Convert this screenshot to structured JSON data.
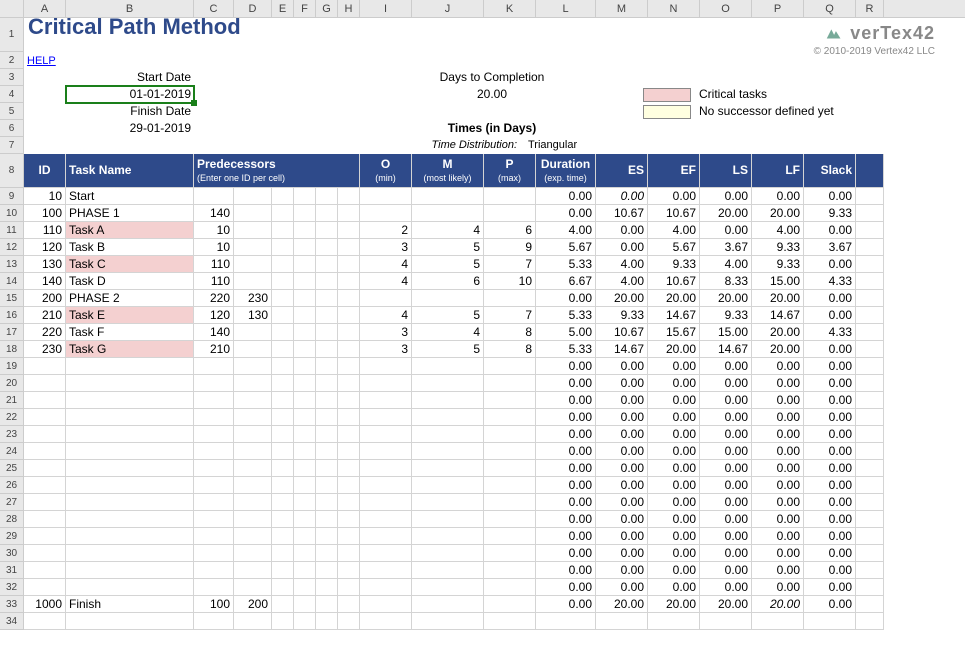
{
  "title": "Critical Path Method",
  "brand": "verTex42",
  "copyright": "© 2010-2019 Vertex42 LLC",
  "help": "HELP",
  "labels": {
    "start_date": "Start Date",
    "start_date_val": "01-01-2019",
    "finish_date": "Finish Date",
    "finish_date_val": "29-01-2019",
    "days_to_completion": "Days to Completion",
    "days_to_completion_val": "20.00",
    "times_heading": "Times (in Days)",
    "time_dist_label": "Time Distribution:",
    "time_dist_val": "Triangular",
    "legend_crit": "Critical tasks",
    "legend_nosucc": "No successor defined yet"
  },
  "headers": {
    "id": "ID",
    "task_name": "Task Name",
    "predecessors": "Predecessors",
    "predecessors_sub": "(Enter one ID per cell)",
    "o": "O",
    "o_sub": "(min)",
    "m": "M",
    "m_sub": "(most likely)",
    "p": "P",
    "p_sub": "(max)",
    "duration": "Duration",
    "duration_sub": "(exp. time)",
    "es": "ES",
    "ef": "EF",
    "ls": "LS",
    "lf": "LF",
    "slack": "Slack"
  },
  "column_letters": [
    "A",
    "B",
    "C",
    "D",
    "E",
    "F",
    "G",
    "H",
    "I",
    "J",
    "K",
    "L",
    "M",
    "N",
    "O",
    "P",
    "Q",
    "R"
  ],
  "row_numbers_section1": [
    "1",
    "2",
    "3",
    "4",
    "5",
    "6",
    "7"
  ],
  "row_numbers_section2": [
    "8"
  ],
  "row_numbers_section3": [
    "9",
    "10",
    "11",
    "12",
    "13",
    "14",
    "15",
    "16",
    "17",
    "18",
    "19",
    "20",
    "21",
    "22",
    "23",
    "24",
    "25",
    "26",
    "27",
    "28",
    "29",
    "30",
    "31",
    "32",
    "33",
    "34"
  ],
  "tasks": [
    {
      "id": "10",
      "name": "Start",
      "pred": [
        "",
        ""
      ],
      "o": "",
      "m": "",
      "p": "",
      "dur": "0.00",
      "es": "0.00",
      "es_i": true,
      "ef": "0.00",
      "ls": "0.00",
      "lf": "0.00",
      "slack": "0.00",
      "crit": false
    },
    {
      "id": "100",
      "name": "PHASE 1",
      "pred": [
        "140",
        ""
      ],
      "o": "",
      "m": "",
      "p": "",
      "dur": "0.00",
      "es": "10.67",
      "es_i": false,
      "ef": "10.67",
      "ls": "20.00",
      "lf": "20.00",
      "slack": "9.33",
      "crit": false
    },
    {
      "id": "110",
      "name": "Task A",
      "pred": [
        "10",
        ""
      ],
      "o": "2",
      "m": "4",
      "p": "6",
      "dur": "4.00",
      "es": "0.00",
      "es_i": false,
      "ef": "4.00",
      "ls": "0.00",
      "lf": "4.00",
      "slack": "0.00",
      "crit": true
    },
    {
      "id": "120",
      "name": "Task B",
      "pred": [
        "10",
        ""
      ],
      "o": "3",
      "m": "5",
      "p": "9",
      "dur": "5.67",
      "es": "0.00",
      "es_i": false,
      "ef": "5.67",
      "ls": "3.67",
      "lf": "9.33",
      "slack": "3.67",
      "crit": false
    },
    {
      "id": "130",
      "name": "Task C",
      "pred": [
        "110",
        ""
      ],
      "o": "4",
      "m": "5",
      "p": "7",
      "dur": "5.33",
      "es": "4.00",
      "es_i": false,
      "ef": "9.33",
      "ls": "4.00",
      "lf": "9.33",
      "slack": "0.00",
      "crit": true
    },
    {
      "id": "140",
      "name": "Task D",
      "pred": [
        "110",
        ""
      ],
      "o": "4",
      "m": "6",
      "p": "10",
      "dur": "6.67",
      "es": "4.00",
      "es_i": false,
      "ef": "10.67",
      "ls": "8.33",
      "lf": "15.00",
      "slack": "4.33",
      "crit": false
    },
    {
      "id": "200",
      "name": "PHASE 2",
      "pred": [
        "220",
        "230"
      ],
      "o": "",
      "m": "",
      "p": "",
      "dur": "0.00",
      "es": "20.00",
      "es_i": false,
      "ef": "20.00",
      "ls": "20.00",
      "lf": "20.00",
      "slack": "0.00",
      "crit": false
    },
    {
      "id": "210",
      "name": "Task E",
      "pred": [
        "120",
        "130"
      ],
      "o": "4",
      "m": "5",
      "p": "7",
      "dur": "5.33",
      "es": "9.33",
      "es_i": false,
      "ef": "14.67",
      "ls": "9.33",
      "lf": "14.67",
      "slack": "0.00",
      "crit": true
    },
    {
      "id": "220",
      "name": "Task F",
      "pred": [
        "140",
        ""
      ],
      "o": "3",
      "m": "4",
      "p": "8",
      "dur": "5.00",
      "es": "10.67",
      "es_i": false,
      "ef": "15.67",
      "ls": "15.00",
      "lf": "20.00",
      "slack": "4.33",
      "crit": false
    },
    {
      "id": "230",
      "name": "Task G",
      "pred": [
        "210",
        ""
      ],
      "o": "3",
      "m": "5",
      "p": "8",
      "dur": "5.33",
      "es": "14.67",
      "es_i": false,
      "ef": "20.00",
      "ls": "14.67",
      "lf": "20.00",
      "slack": "0.00",
      "crit": true
    }
  ],
  "empty_rows": 14,
  "empty_vals": {
    "dur": "0.00",
    "es": "0.00",
    "ef": "0.00",
    "ls": "0.00",
    "lf": "0.00",
    "slack": "0.00"
  },
  "finish": {
    "id": "1000",
    "name": "Finish",
    "pred": [
      "100",
      "200"
    ],
    "dur": "0.00",
    "es": "20.00",
    "ef": "20.00",
    "ls": "20.00",
    "lf": "20.00",
    "lf_i": true,
    "slack": "0.00"
  }
}
